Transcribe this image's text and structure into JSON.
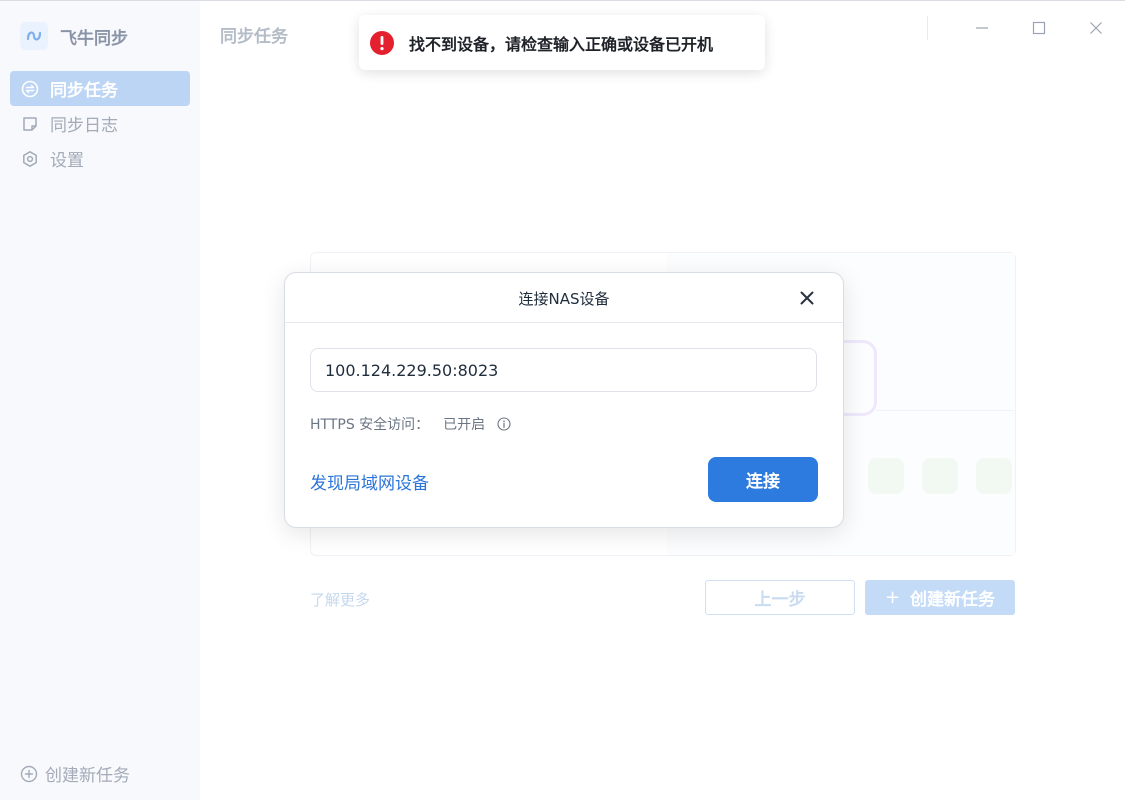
{
  "app": {
    "name": "飞牛同步"
  },
  "sidebar": {
    "items": [
      {
        "label": "同步任务",
        "icon": "sync-circle-icon",
        "active": true
      },
      {
        "label": "同步日志",
        "icon": "note-icon",
        "active": false
      },
      {
        "label": "设置",
        "icon": "gear-icon",
        "active": false
      }
    ],
    "new_task_label": "创建新任务"
  },
  "header": {
    "title": "同步任务"
  },
  "toast": {
    "message": "找不到设备，请检查输入正确或设备已开机",
    "type": "error",
    "color": "#e5202e"
  },
  "main": {
    "learn_more": "了解更多",
    "prev_button": "上一步",
    "create_button": "创建新任务"
  },
  "modal": {
    "title": "连接NAS设备",
    "address_value": "100.124.229.50:8023",
    "https_label": "HTTPS 安全访问：",
    "https_value": "已开启",
    "discover_link": "发现局域网设备",
    "connect_button": "连接"
  },
  "colors": {
    "primary": "#2e7be0",
    "link": "#2b74d9",
    "active_nav_bg": "#bcd5f5"
  }
}
